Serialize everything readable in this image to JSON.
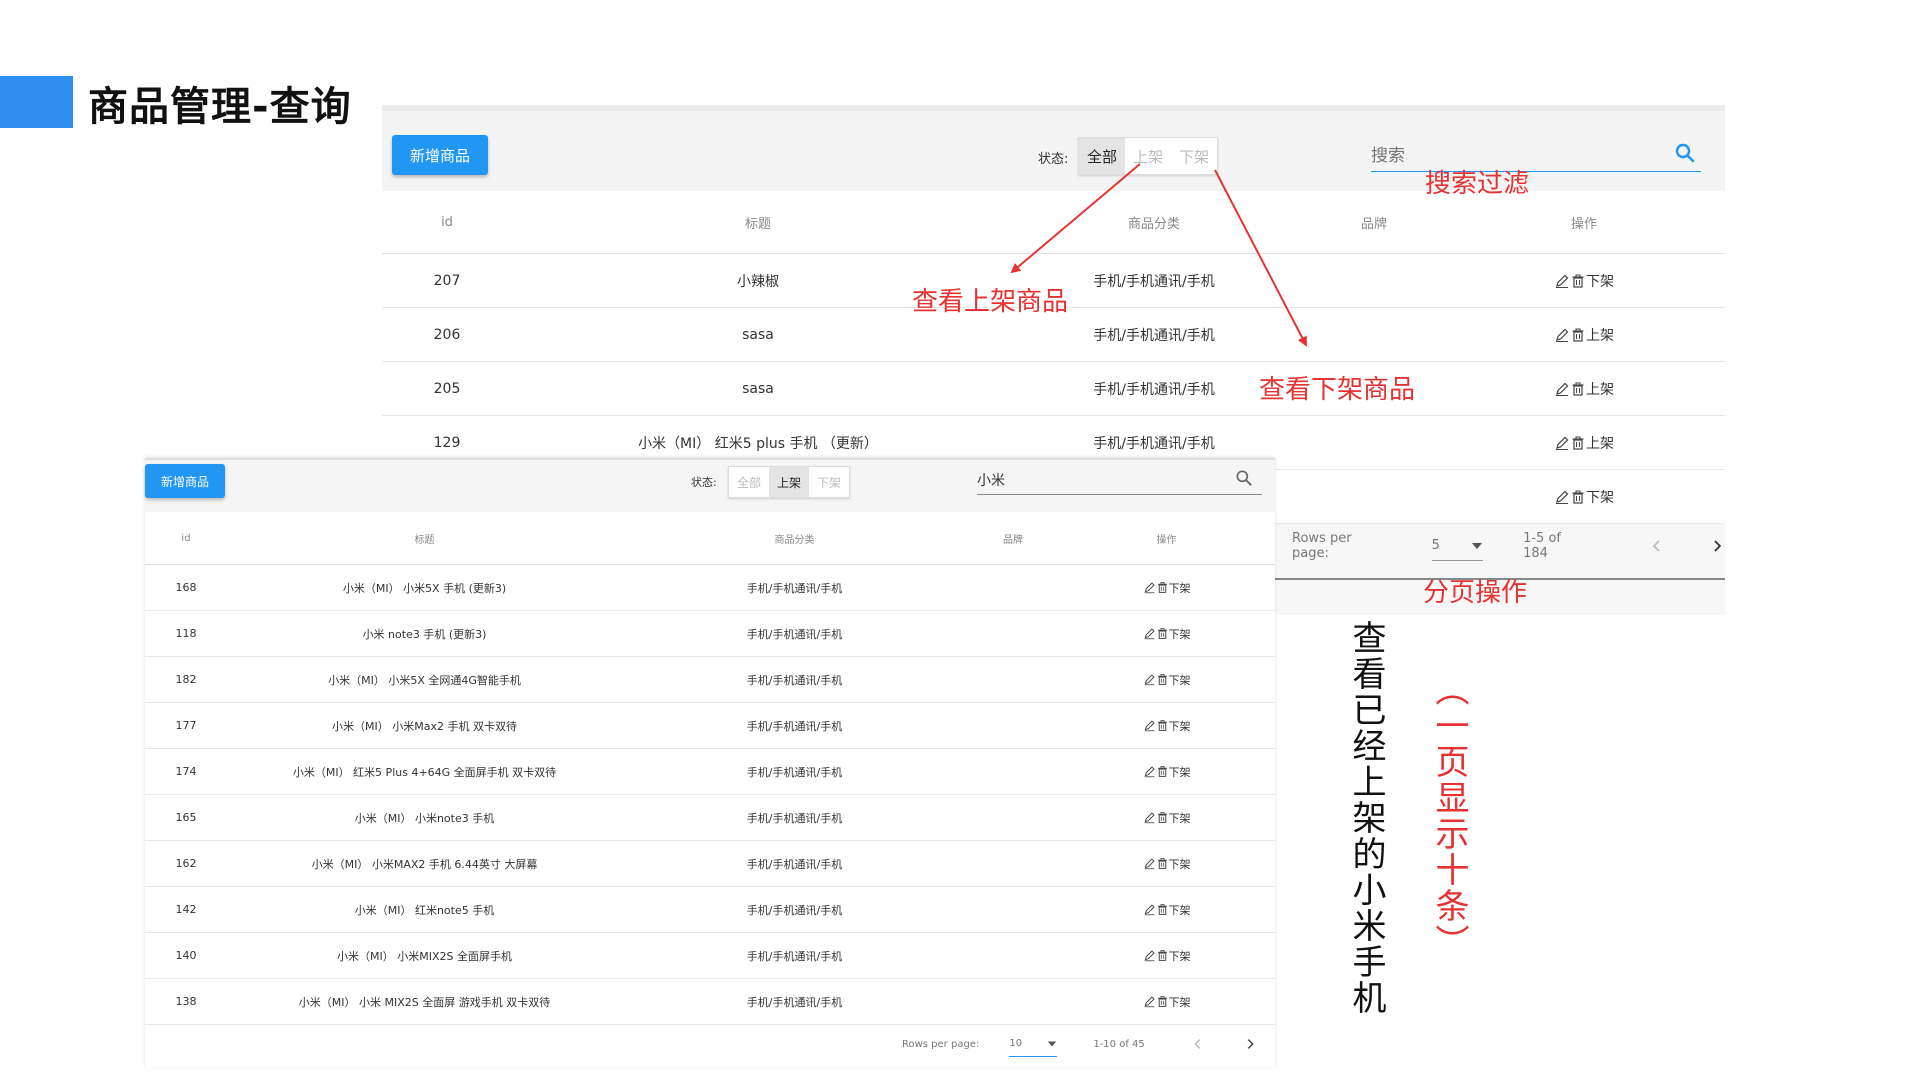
{
  "slide": {
    "title": "商品管理-查询"
  },
  "back_panel": {
    "add_button": "新增商品",
    "status_label": "状态:",
    "status_options": [
      "全部",
      "上架",
      "下架"
    ],
    "search_placeholder": "搜索",
    "columns": [
      "id",
      "标题",
      "商品分类",
      "品牌",
      "操作"
    ],
    "rows": [
      {
        "id": "207",
        "title": "小辣椒",
        "category": "手机/手机通讯/手机",
        "brand": "",
        "action": "下架"
      },
      {
        "id": "206",
        "title": "sasa",
        "category": "手机/手机通讯/手机",
        "brand": "",
        "action": "上架"
      },
      {
        "id": "205",
        "title": "sasa",
        "category": "手机/手机通讯/手机",
        "brand": "",
        "action": "上架"
      },
      {
        "id": "129",
        "title": "小米（MI） 红米5 plus 手机 （更新）",
        "category": "手机/手机通讯/手机",
        "brand": "",
        "action": "上架"
      },
      {
        "id": "",
        "title": "",
        "category": "",
        "brand": "",
        "action": "下架"
      }
    ],
    "pager": {
      "rows_per_page_label": "Rows per page:",
      "rows_per_page": "5",
      "range": "1-5 of 184"
    }
  },
  "front_panel": {
    "add_button": "新增商品",
    "status_label": "状态:",
    "status_options": [
      "全部",
      "上架",
      "下架"
    ],
    "search_value": "小米",
    "columns": [
      "id",
      "标题",
      "商品分类",
      "品牌",
      "操作"
    ],
    "rows": [
      {
        "id": "168",
        "title": "小米（MI） 小米5X 手机 (更新3)",
        "category": "手机/手机通讯/手机",
        "brand": "",
        "action": "下架"
      },
      {
        "id": "118",
        "title": "小米 note3 手机 (更新3)",
        "category": "手机/手机通讯/手机",
        "brand": "",
        "action": "下架"
      },
      {
        "id": "182",
        "title": "小米（MI） 小米5X 全网通4G智能手机",
        "category": "手机/手机通讯/手机",
        "brand": "",
        "action": "下架"
      },
      {
        "id": "177",
        "title": "小米（MI） 小米Max2 手机 双卡双待",
        "category": "手机/手机通讯/手机",
        "brand": "",
        "action": "下架"
      },
      {
        "id": "174",
        "title": "小米（MI） 红米5 Plus 4+64G 全面屏手机 双卡双待",
        "category": "手机/手机通讯/手机",
        "brand": "",
        "action": "下架"
      },
      {
        "id": "165",
        "title": "小米（MI） 小米note3 手机",
        "category": "手机/手机通讯/手机",
        "brand": "",
        "action": "下架"
      },
      {
        "id": "162",
        "title": "小米（MI） 小米MAX2 手机 6.44英寸 大屏幕",
        "category": "手机/手机通讯/手机",
        "brand": "",
        "action": "下架"
      },
      {
        "id": "142",
        "title": "小米（MI） 红米note5 手机",
        "category": "手机/手机通讯/手机",
        "brand": "",
        "action": "下架"
      },
      {
        "id": "140",
        "title": "小米（MI） 小米MIX2S 全面屏手机",
        "category": "手机/手机通讯/手机",
        "brand": "",
        "action": "下架"
      },
      {
        "id": "138",
        "title": "小米（MI） 小米 MIX2S 全面屏 游戏手机 双卡双待",
        "category": "手机/手机通讯/手机",
        "brand": "",
        "action": "下架"
      }
    ],
    "pager": {
      "rows_per_page_label": "Rows per page:",
      "rows_per_page": "10",
      "range": "1-10 of 45"
    }
  },
  "annotations": {
    "search_filter": "搜索过滤",
    "view_listed": "查看上架商品",
    "view_unlisted": "查看下架商品",
    "pagination": "分页操作",
    "vertical_black": "查看已经上架的小米手机",
    "vertical_red": "（一页显示十条）"
  },
  "colors": {
    "primary": "#2196f3",
    "annotation_red": "#e53333",
    "accent_bar": "#2f8ff0"
  },
  "icons": {
    "edit": "pencil-icon",
    "delete": "trash-icon",
    "search": "search-icon",
    "dropdown": "caret-down-icon",
    "prev": "chevron-left-icon",
    "next": "chevron-right-icon"
  }
}
